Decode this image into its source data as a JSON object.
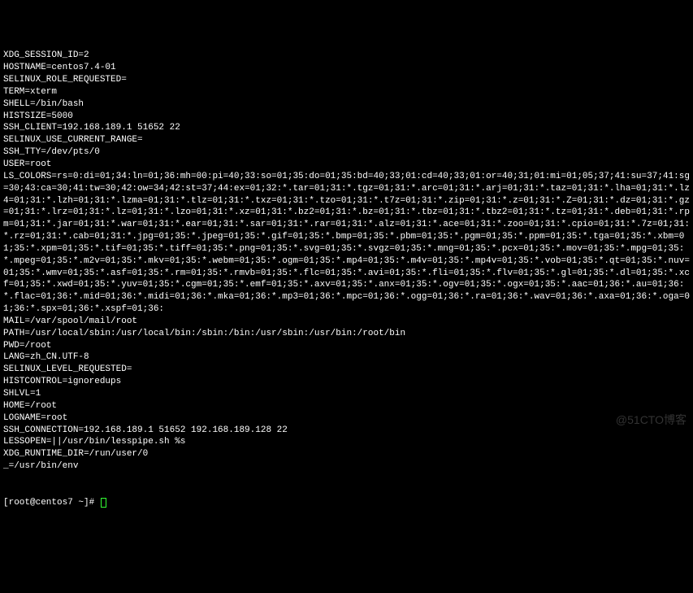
{
  "lines": [
    "XDG_SESSION_ID=2",
    "HOSTNAME=centos7.4-01",
    "SELINUX_ROLE_REQUESTED=",
    "TERM=xterm",
    "SHELL=/bin/bash",
    "HISTSIZE=5000",
    "SSH_CLIENT=192.168.189.1 51652 22",
    "SELINUX_USE_CURRENT_RANGE=",
    "SSH_TTY=/dev/pts/0",
    "USER=root",
    "LS_COLORS=rs=0:di=01;34:ln=01;36:mh=00:pi=40;33:so=01;35:do=01;35:bd=40;33;01:cd=40;33;01:or=40;31;01:mi=01;05;37;41:su=37;41:sg=30;43:ca=30;41:tw=30;42:ow=34;42:st=37;44:ex=01;32:*.tar=01;31:*.tgz=01;31:*.arc=01;31:*.arj=01;31:*.taz=01;31:*.lha=01;31:*.lz4=01;31:*.lzh=01;31:*.lzma=01;31:*.tlz=01;31:*.txz=01;31:*.tzo=01;31:*.t7z=01;31:*.zip=01;31:*.z=01;31:*.Z=01;31:*.dz=01;31:*.gz=01;31:*.lrz=01;31:*.lz=01;31:*.lzo=01;31:*.xz=01;31:*.bz2=01;31:*.bz=01;31:*.tbz=01;31:*.tbz2=01;31:*.tz=01;31:*.deb=01;31:*.rpm=01;31:*.jar=01;31:*.war=01;31:*.ear=01;31:*.sar=01;31:*.rar=01;31:*.alz=01;31:*.ace=01;31:*.zoo=01;31:*.cpio=01;31:*.7z=01;31:*.rz=01;31:*.cab=01;31:*.jpg=01;35:*.jpeg=01;35:*.gif=01;35:*.bmp=01;35:*.pbm=01;35:*.pgm=01;35:*.ppm=01;35:*.tga=01;35:*.xbm=01;35:*.xpm=01;35:*.tif=01;35:*.tiff=01;35:*.png=01;35:*.svg=01;35:*.svgz=01;35:*.mng=01;35:*.pcx=01;35:*.mov=01;35:*.mpg=01;35:*.mpeg=01;35:*.m2v=01;35:*.mkv=01;35:*.webm=01;35:*.ogm=01;35:*.mp4=01;35:*.m4v=01;35:*.mp4v=01;35:*.vob=01;35:*.qt=01;35:*.nuv=01;35:*.wmv=01;35:*.asf=01;35:*.rm=01;35:*.rmvb=01;35:*.flc=01;35:*.avi=01;35:*.fli=01;35:*.flv=01;35:*.gl=01;35:*.dl=01;35:*.xcf=01;35:*.xwd=01;35:*.yuv=01;35:*.cgm=01;35:*.emf=01;35:*.axv=01;35:*.anx=01;35:*.ogv=01;35:*.ogx=01;35:*.aac=01;36:*.au=01;36:*.flac=01;36:*.mid=01;36:*.midi=01;36:*.mka=01;36:*.mp3=01;36:*.mpc=01;36:*.ogg=01;36:*.ra=01;36:*.wav=01;36:*.axa=01;36:*.oga=01;36:*.spx=01;36:*.xspf=01;36:",
    "MAIL=/var/spool/mail/root",
    "PATH=/usr/local/sbin:/usr/local/bin:/sbin:/bin:/usr/sbin:/usr/bin:/root/bin",
    "PWD=/root",
    "LANG=zh_CN.UTF-8",
    "SELINUX_LEVEL_REQUESTED=",
    "HISTCONTROL=ignoredups",
    "SHLVL=1",
    "HOME=/root",
    "LOGNAME=root",
    "SSH_CONNECTION=192.168.189.1 51652 192.168.189.128 22",
    "LESSOPEN=||/usr/bin/lesspipe.sh %s",
    "XDG_RUNTIME_DIR=/run/user/0",
    "_=/usr/bin/env"
  ],
  "prompt": "[root@centos7 ~]# ",
  "watermark": "@51CTO博客"
}
